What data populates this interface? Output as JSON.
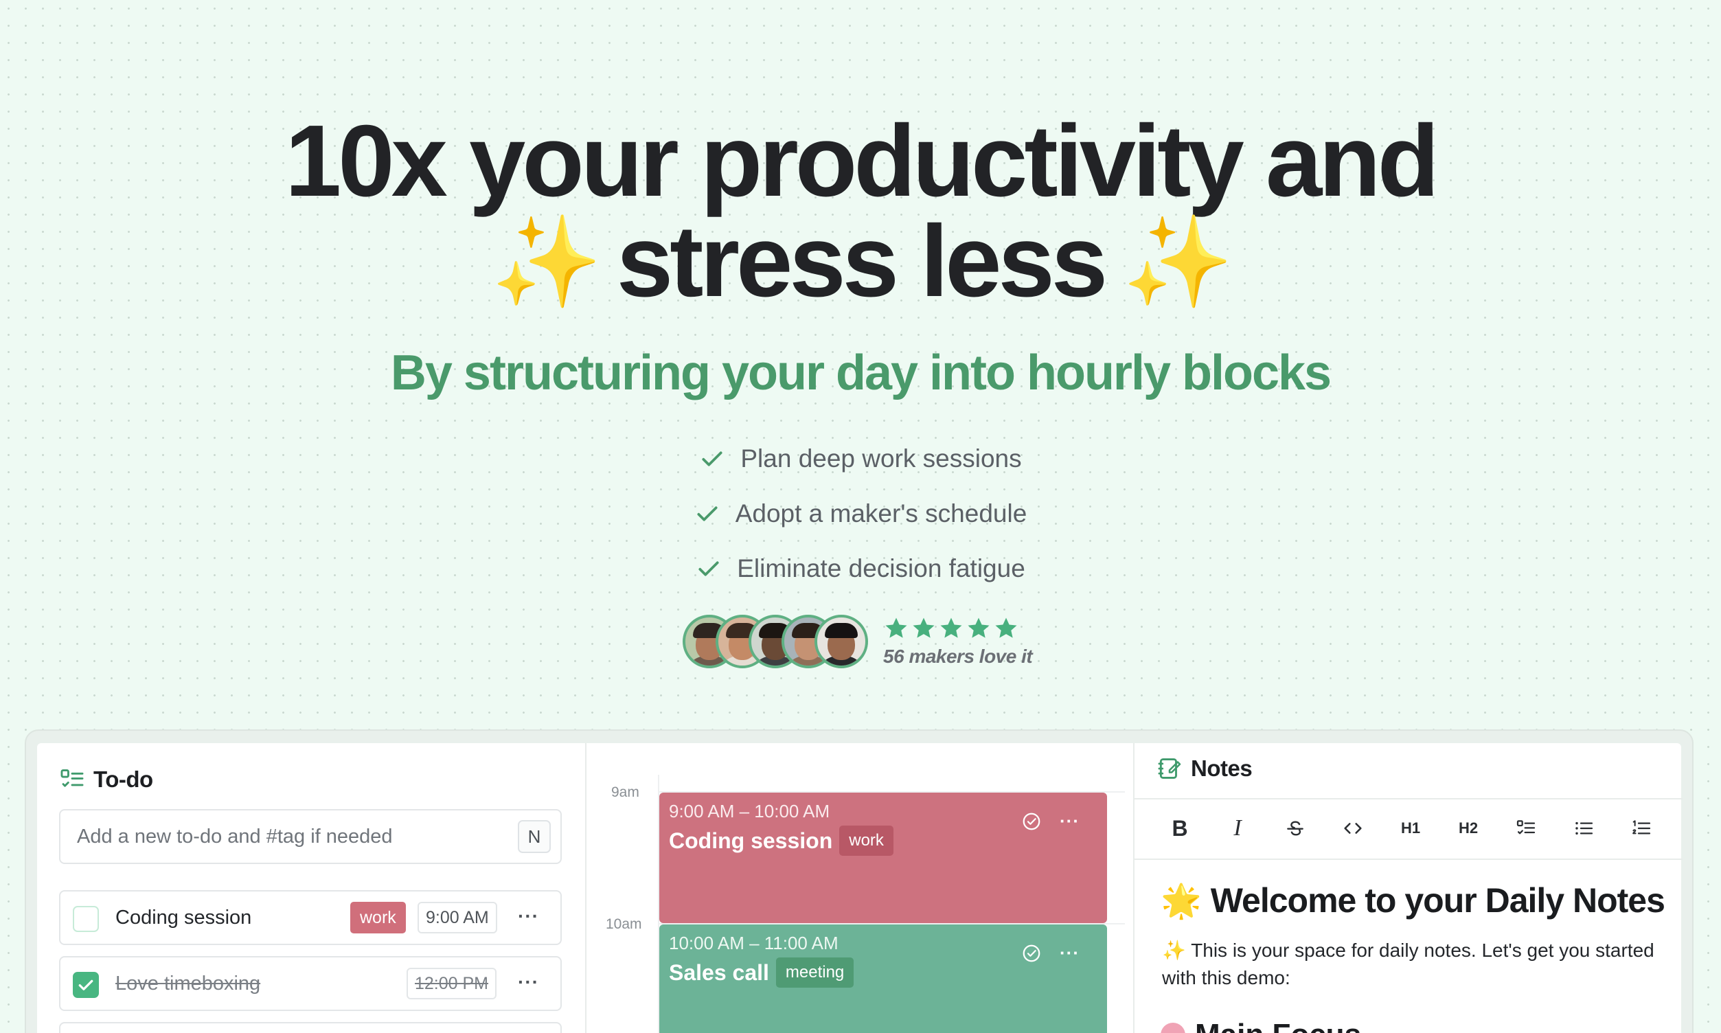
{
  "hero": {
    "headline_line1": "10x your productivity and",
    "headline_line2": "stress less",
    "sparkle": "✨",
    "subheadline": "By structuring your day into hourly blocks",
    "bullets": [
      "Plan deep work sessions",
      "Adopt a maker's schedule",
      "Eliminate decision fatigue"
    ],
    "rating_stars": 5,
    "makers_count": "56",
    "makers_text": "makers love it",
    "colors": {
      "accent": "#4a9a6b",
      "star": "#48b07e",
      "background": "#eefaf3"
    }
  },
  "todo": {
    "title": "To-do",
    "input_placeholder": "Add a new to-do and #tag if needed",
    "shortcut_key": "N",
    "items": [
      {
        "label": "Coding session",
        "tag": "work",
        "time": "9:00 AM",
        "done": false,
        "more": "···"
      },
      {
        "label": "Love timeboxing",
        "tag": "",
        "time": "12:00 PM",
        "done": true,
        "more": "···"
      }
    ]
  },
  "calendar": {
    "hours": [
      "9am",
      "10am"
    ],
    "events": [
      {
        "time": "9:00 AM – 10:00 AM",
        "title": "Coding session",
        "tag": "work",
        "color": "#cd727f",
        "more": "···"
      },
      {
        "time": "10:00 AM – 11:00 AM",
        "title": "Sales call",
        "tag": "meeting",
        "color": "#6cb397",
        "more": "···"
      }
    ]
  },
  "notes": {
    "title": "Notes",
    "toolbar": [
      "B",
      "I",
      "strikethrough",
      "code",
      "H1",
      "H2",
      "task-list",
      "bullet-list",
      "numbered-list"
    ],
    "heading_emoji": "🌟",
    "heading": "Welcome to your Daily Notes",
    "intro_emoji": "✨",
    "intro": "This is your space for daily notes. Let's get you started with this demo:",
    "subheading_emoji": "🧠",
    "subheading": "Main Focus"
  }
}
